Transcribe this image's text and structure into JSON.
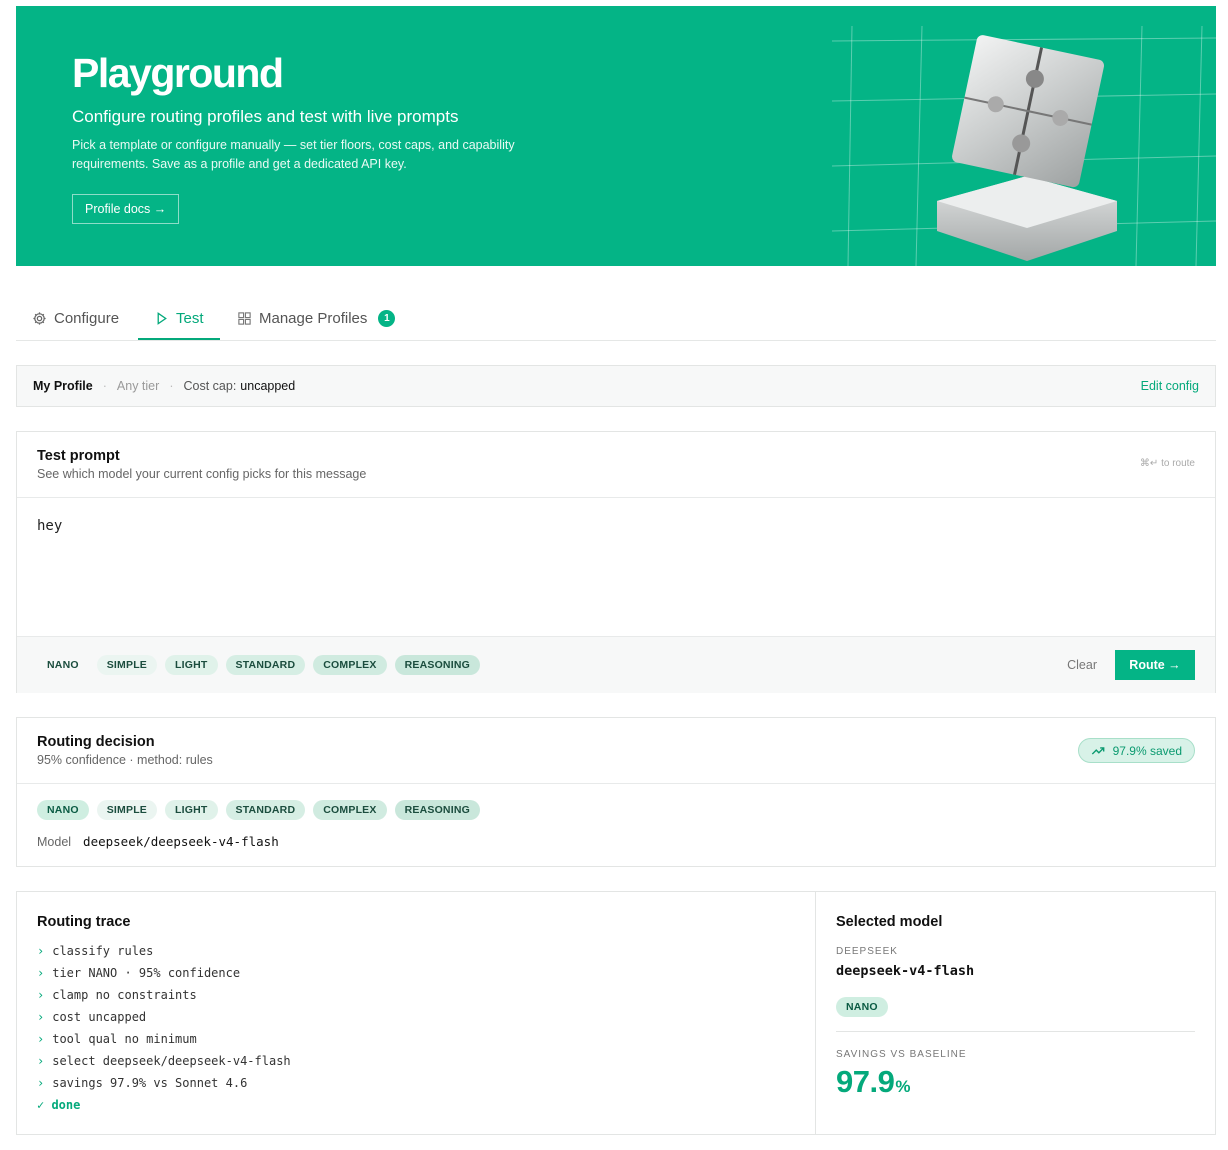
{
  "hero": {
    "title": "Playground",
    "subtitle": "Configure routing profiles and test with live prompts",
    "description": "Pick a template or configure manually — set tier floors, cost caps, and capability requirements. Save as a profile and get a dedicated API key.",
    "docs_button": "Profile docs →"
  },
  "tabs": [
    {
      "label": "Configure",
      "icon": "gear-icon",
      "active": false
    },
    {
      "label": "Test",
      "icon": "play-icon",
      "active": true
    },
    {
      "label": "Manage Profiles",
      "icon": "grid-icon",
      "active": false,
      "count": "1"
    }
  ],
  "profile_bar": {
    "name": "My Profile",
    "tier": "Any tier",
    "cost_label": "Cost cap:",
    "cost_value": "uncapped",
    "edit": "Edit config"
  },
  "test_prompt": {
    "title": "Test prompt",
    "subtitle": "See which model your current config picks for this message",
    "hint": "⌘↵ to route",
    "value": "hey",
    "tiers": [
      "NANO",
      "SIMPLE",
      "LIGHT",
      "STANDARD",
      "COMPLEX",
      "REASONING"
    ],
    "clear": "Clear",
    "route": "Route →"
  },
  "decision": {
    "title": "Routing decision",
    "subtitle": "95% confidence · method: rules",
    "saved": "97.9% saved",
    "tiers": [
      "NANO",
      "SIMPLE",
      "LIGHT",
      "STANDARD",
      "COMPLEX",
      "REASONING"
    ],
    "selected_tier": "NANO",
    "model_label": "Model",
    "model_value": "deepseek/deepseek-v4-flash"
  },
  "trace": {
    "title": "Routing trace",
    "lines": [
      "classify rules",
      "tier NANO · 95% confidence",
      "clamp no constraints",
      "cost uncapped",
      "tool qual no minimum",
      "select deepseek/deepseek-v4-flash",
      "savings 97.9% vs Sonnet 4.6"
    ],
    "done": "✓ done"
  },
  "selected": {
    "title": "Selected model",
    "provider": "DEEPSEEK",
    "model": "deepseek-v4-flash",
    "tier": "NANO",
    "savings_label": "SAVINGS VS BASELINE",
    "savings_value": "97.9",
    "savings_unit": "%"
  },
  "colors": {
    "accent": "#04b486",
    "accent_text": "#04a97b"
  }
}
